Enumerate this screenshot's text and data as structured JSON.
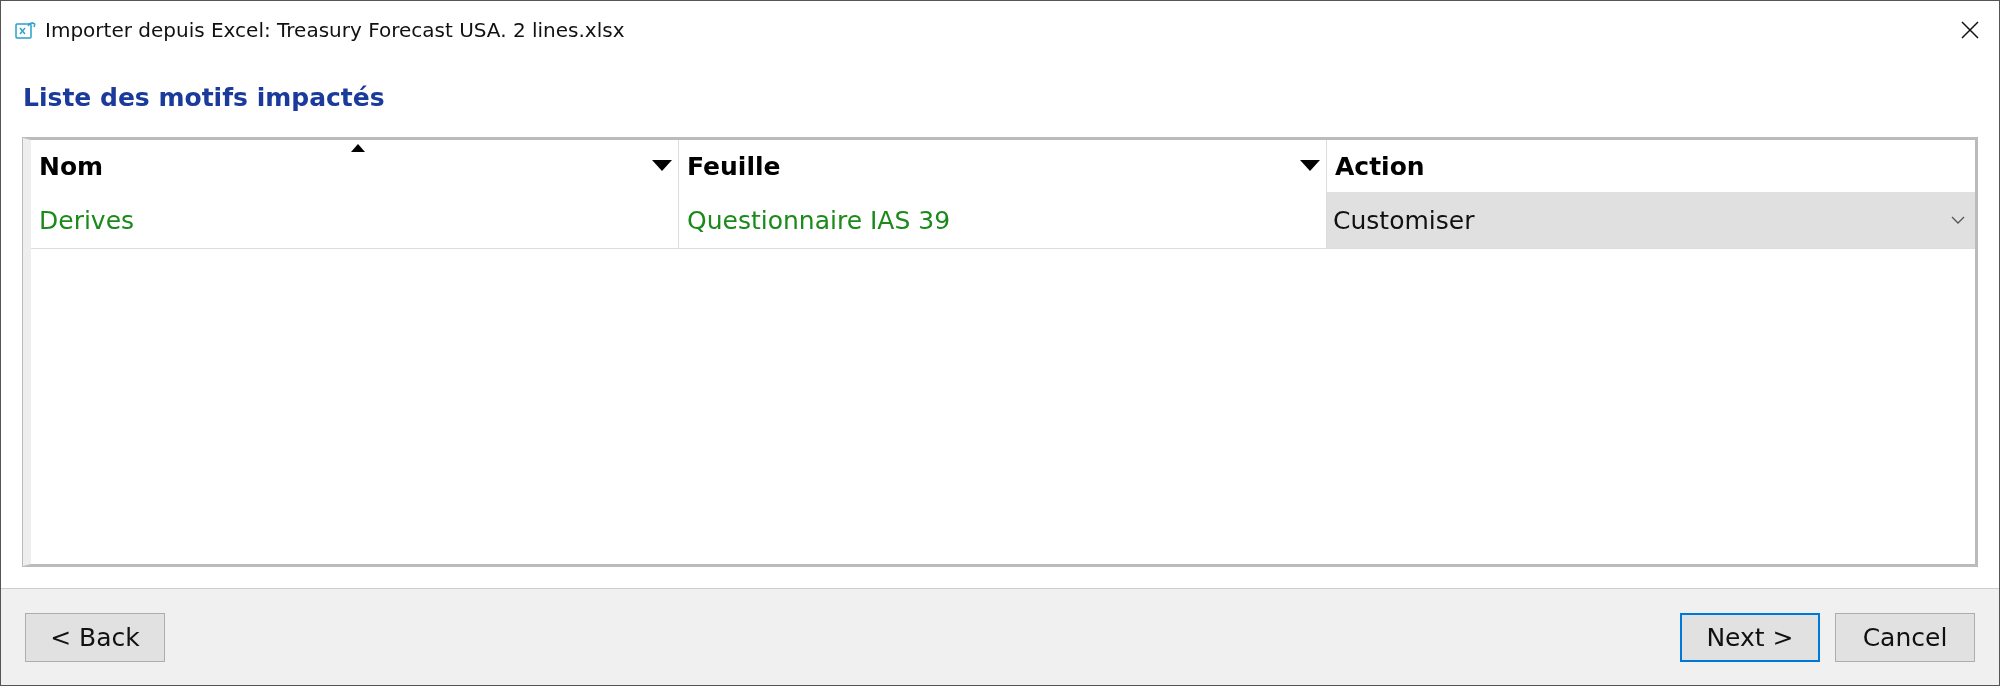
{
  "window": {
    "title": "Importer depuis Excel: Treasury Forecast USA. 2 lines.xlsx"
  },
  "heading": "Liste des motifs impactés",
  "table": {
    "columns": [
      {
        "label": "Nom",
        "sorted": true,
        "filter": true
      },
      {
        "label": "Feuille",
        "sorted": false,
        "filter": true
      },
      {
        "label": "Action",
        "sorted": false,
        "filter": false
      }
    ],
    "rows": [
      {
        "nom": "Derives",
        "feuille": "Questionnaire IAS 39",
        "action": "Customiser"
      }
    ]
  },
  "buttons": [
    {
      "label": "< Back",
      "default": false
    },
    {
      "label": "Next >",
      "default": true
    },
    {
      "label": "Cancel",
      "default": false
    }
  ]
}
